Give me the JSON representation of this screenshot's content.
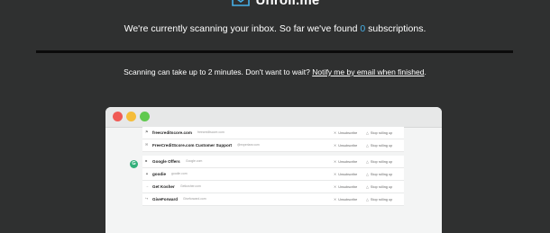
{
  "logo": {
    "text": "Unroll.me"
  },
  "scan": {
    "status_prefix": "We're currently scanning your inbox. So far we've found",
    "count": "0",
    "status_suffix": "subscriptions.",
    "progress": 0
  },
  "wait_note": {
    "text": "Scanning can take up to 2 minutes. Don't want to wait?",
    "link": "Notify me by email when finished",
    "after": "."
  },
  "preview": {
    "group_letter": "G",
    "actions": {
      "unsubscribe": "Unsubscribe",
      "stop": "Stop rolling up"
    },
    "group1": [
      {
        "icon": "flag-icon",
        "sender": "freecreditscore.com",
        "domain": "freecreditscore.com"
      },
      {
        "icon": "mail-icon",
        "sender": "FreeCreditScore.com Customer Support",
        "domain": "@experianr.com"
      }
    ],
    "group2": [
      {
        "icon": "google-icon",
        "sender": "Google Offers",
        "domain": "Google.com"
      },
      {
        "icon": "goodie-icon",
        "sender": "goodie",
        "domain": "goodie.com"
      },
      {
        "icon": "arrow-icon",
        "sender": "Get Kosher",
        "domain": "Getkosher.com"
      },
      {
        "icon": "forward-icon",
        "sender": "GiveForward",
        "domain": "Giveforward.com"
      }
    ]
  },
  "colors": {
    "accent": "#46b0e8",
    "background": "#2f3030",
    "group_badge": "#33b07a"
  }
}
